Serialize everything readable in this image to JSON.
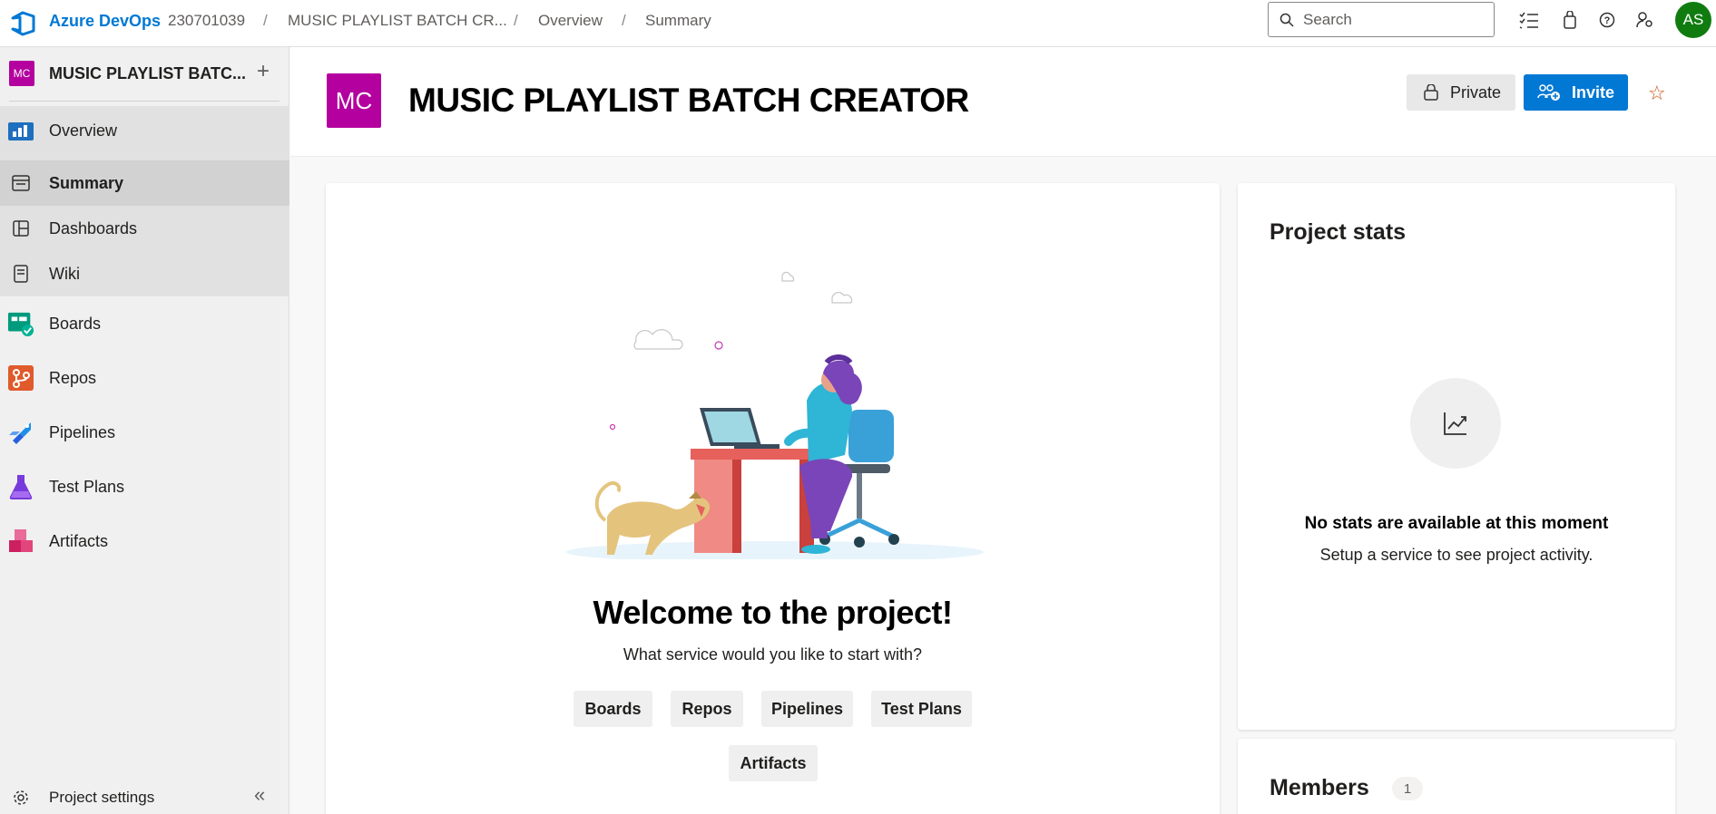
{
  "topbar": {
    "brand": "Azure DevOps",
    "breadcrumbs": [
      "230701039",
      "MUSIC PLAYLIST BATCH CR...",
      "Overview",
      "Summary"
    ],
    "search_placeholder": "Search",
    "avatar_initials": "AS",
    "icons": [
      "work-items-icon",
      "marketplace-icon",
      "help-icon",
      "user-settings-icon"
    ]
  },
  "sidebar": {
    "project_badge": "MC",
    "project_name": "MUSIC PLAYLIST BATC...",
    "items": [
      {
        "label": "Overview",
        "icon": "overview-icon"
      },
      {
        "label": "Summary",
        "icon": "summary-icon"
      },
      {
        "label": "Dashboards",
        "icon": "dashboards-icon"
      },
      {
        "label": "Wiki",
        "icon": "wiki-icon"
      },
      {
        "label": "Boards",
        "icon": "boards-icon"
      },
      {
        "label": "Repos",
        "icon": "repos-icon"
      },
      {
        "label": "Pipelines",
        "icon": "pipelines-icon"
      },
      {
        "label": "Test Plans",
        "icon": "test-plans-icon"
      },
      {
        "label": "Artifacts",
        "icon": "artifacts-icon"
      }
    ],
    "settings_label": "Project settings"
  },
  "header": {
    "badge": "MC",
    "title": "MUSIC PLAYLIST BATCH CREATOR",
    "private_label": "Private",
    "invite_label": "Invite"
  },
  "welcome": {
    "title": "Welcome to the project!",
    "subtitle": "What service would you like to start with?",
    "services": [
      "Boards",
      "Repos",
      "Pipelines",
      "Test Plans",
      "Artifacts"
    ]
  },
  "stats": {
    "title": "Project stats",
    "empty_title": "No stats are available at this moment",
    "empty_subtitle": "Setup a service to see project activity."
  },
  "members": {
    "title": "Members",
    "count": "1"
  },
  "colors": {
    "accent": "#0078d4",
    "project_badge": "#b4009e",
    "avatar": "#107c10",
    "star": "#ca5010"
  }
}
